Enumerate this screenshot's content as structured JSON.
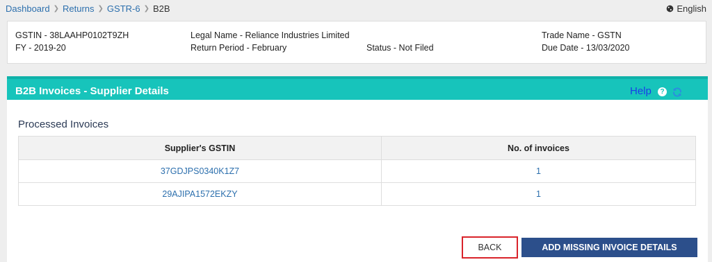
{
  "breadcrumb": {
    "items": [
      "Dashboard",
      "Returns",
      "GSTR-6"
    ],
    "current": "B2B"
  },
  "language": "English",
  "info": {
    "gstin": "GSTIN - 38LAAHP0102T9ZH",
    "fy": "FY - 2019-20",
    "legal_name": "Legal Name - Reliance Industries Limited",
    "return_period": "Return Period - February",
    "status": "Status - Not Filed",
    "trade_name": "Trade Name - GSTN",
    "due_date": "Due Date - 13/03/2020"
  },
  "panel": {
    "title": "B2B Invoices - Supplier Details",
    "help": "Help"
  },
  "section_label": "Processed Invoices",
  "table": {
    "headers": [
      "Supplier's GSTIN",
      "No. of invoices"
    ],
    "rows": [
      [
        "37GDJPS0340K1Z7",
        "1"
      ],
      [
        "29AJIPA1572EKZY",
        "1"
      ]
    ]
  },
  "buttons": {
    "back": "BACK",
    "add_missing": "ADD MISSING INVOICE DETAILS"
  },
  "colors": {
    "header_teal": "#17c4bb",
    "link_blue": "#2c6fad",
    "primary_button": "#2c4f8b",
    "highlight_red": "#d9232a"
  },
  "icons": [
    "globe-icon",
    "help-icon",
    "refresh-icon",
    "chevron-right-icon"
  ]
}
